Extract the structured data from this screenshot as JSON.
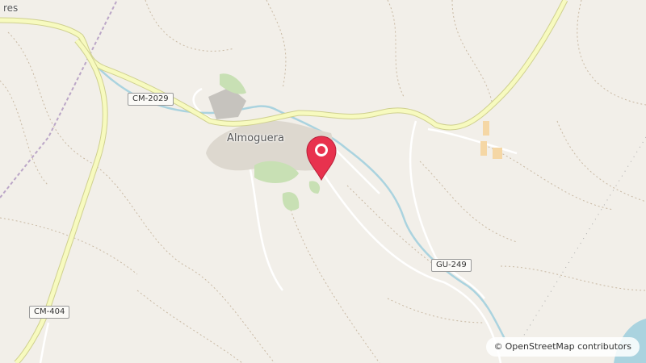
{
  "map": {
    "place_label": "Almoguera",
    "partial_label": "res",
    "roads": {
      "cm2029": "CM-2029",
      "gu249": "GU-249",
      "cm404": "CM-404"
    },
    "attribution": {
      "symbol": "©",
      "text": "OpenStreetMap contributors"
    },
    "colors": {
      "background": "#f2efe9",
      "major_road": "#f7fabf",
      "major_road_casing": "#cfd08f",
      "water": "#aad3df",
      "park": "#c8e0b4",
      "marker": "#e8324e",
      "industrial": "#f5d7a5"
    },
    "icons": {
      "marker": "map-pin-icon"
    }
  }
}
